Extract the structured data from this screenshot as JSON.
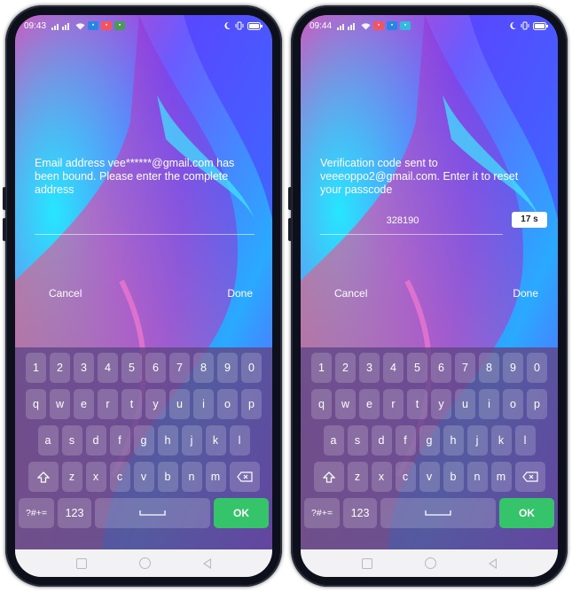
{
  "left_phone": {
    "status": {
      "time": "09:43"
    },
    "message": "Email address vee******@gmail.com has been bound. Please enter the complete address",
    "cancel_label": "Cancel",
    "done_label": "Done"
  },
  "right_phone": {
    "status": {
      "time": "09:44"
    },
    "message": "Verification code sent to veeeoppo2@gmail.com. Enter it to reset your passcode",
    "code_value": "328190",
    "timer_label": "17 s",
    "cancel_label": "Cancel",
    "done_label": "Done"
  },
  "keyboard": {
    "digits": [
      "1",
      "2",
      "3",
      "4",
      "5",
      "6",
      "7",
      "8",
      "9",
      "0"
    ],
    "row1": [
      "q",
      "w",
      "e",
      "r",
      "t",
      "y",
      "u",
      "i",
      "o",
      "p"
    ],
    "row2": [
      "a",
      "s",
      "d",
      "f",
      "g",
      "h",
      "j",
      "k",
      "l"
    ],
    "row3": [
      "z",
      "x",
      "c",
      "v",
      "b",
      "n",
      "m"
    ],
    "symbols_label": "?#+=",
    "numbers_label": "123",
    "ok_label": "OK"
  },
  "icons": {
    "shift": "shift-arrow-icon",
    "delete": "backspace-icon",
    "space": "space-bar-icon",
    "nav_recent": "recent-apps-square-icon",
    "nav_home": "home-circle-icon",
    "nav_back": "back-triangle-icon"
  },
  "colors": {
    "ok_key": "#36c46b",
    "keyboard_bg": "#5f4687"
  }
}
